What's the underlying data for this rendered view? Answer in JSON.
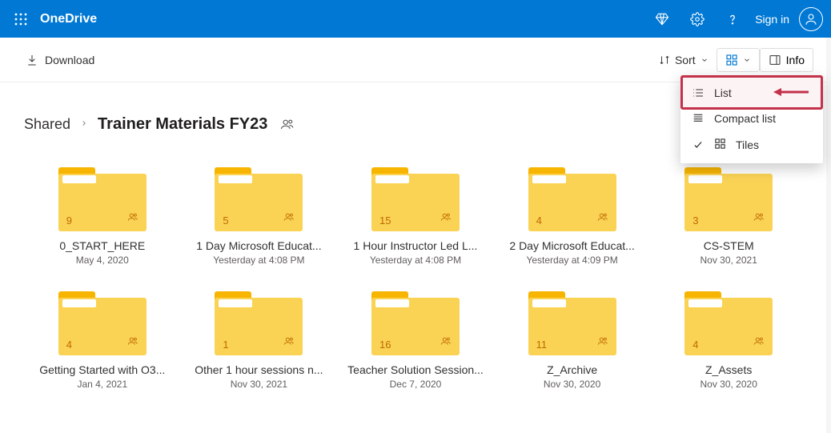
{
  "header": {
    "brand": "OneDrive",
    "signin": "Sign in"
  },
  "cmdbar": {
    "download": "Download",
    "sort": "Sort",
    "info": "Info"
  },
  "crumbs": {
    "shared": "Shared",
    "current": "Trainer Materials FY23"
  },
  "viewmenu": {
    "list": "List",
    "compact": "Compact list",
    "tiles": "Tiles"
  },
  "folders": [
    {
      "count": "9",
      "name": "0_START_HERE",
      "date": "May 4, 2020"
    },
    {
      "count": "5",
      "name": "1 Day Microsoft Educat...",
      "date": "Yesterday at 4:08 PM"
    },
    {
      "count": "15",
      "name": "1 Hour Instructor Led L...",
      "date": "Yesterday at 4:08 PM"
    },
    {
      "count": "4",
      "name": "2 Day Microsoft Educat...",
      "date": "Yesterday at 4:09 PM"
    },
    {
      "count": "3",
      "name": "CS-STEM",
      "date": "Nov 30, 2021"
    },
    {
      "count": "4",
      "name": "Getting Started with O3...",
      "date": "Jan 4, 2021"
    },
    {
      "count": "1",
      "name": "Other 1 hour sessions n...",
      "date": "Nov 30, 2021"
    },
    {
      "count": "16",
      "name": "Teacher Solution Session...",
      "date": "Dec 7, 2020"
    },
    {
      "count": "11",
      "name": "Z_Archive",
      "date": "Nov 30, 2020"
    },
    {
      "count": "4",
      "name": "Z_Assets",
      "date": "Nov 30, 2020"
    }
  ]
}
